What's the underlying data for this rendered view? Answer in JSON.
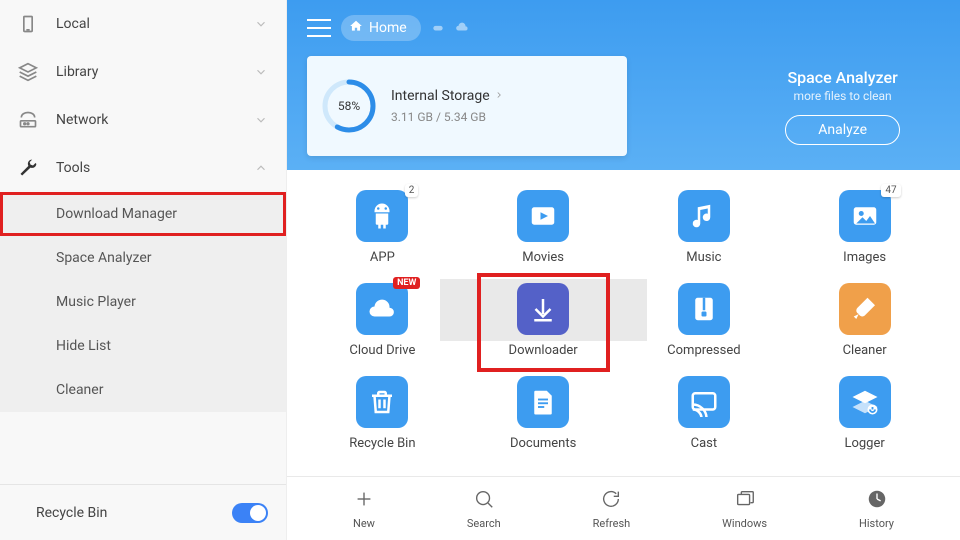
{
  "sidebar": {
    "items": [
      {
        "label": "Local",
        "icon": "phone-icon",
        "expanded": false
      },
      {
        "label": "Library",
        "icon": "stack-icon",
        "expanded": false
      },
      {
        "label": "Network",
        "icon": "router-icon",
        "expanded": false
      },
      {
        "label": "Tools",
        "icon": "wrench-icon",
        "expanded": true
      }
    ],
    "tools_children": [
      {
        "label": "Download Manager",
        "highlighted": true
      },
      {
        "label": "Space Analyzer"
      },
      {
        "label": "Music Player"
      },
      {
        "label": "Hide List"
      },
      {
        "label": "Cleaner"
      }
    ],
    "recycle_bin": "Recycle Bin",
    "recycle_toggle_on": true
  },
  "header": {
    "home_label": "Home",
    "storage": {
      "percent_text": "58%",
      "percent": 58,
      "title": "Internal Storage",
      "detail": "3.11 GB / 5.34 GB"
    },
    "analyzer": {
      "title": "Space Analyzer",
      "subtitle": "more files to clean",
      "button": "Analyze"
    }
  },
  "grid": [
    {
      "name": "app",
      "label": "APP",
      "icon": "android",
      "color": "bg-blue",
      "badge": "2"
    },
    {
      "name": "movies",
      "label": "Movies",
      "icon": "play",
      "color": "bg-blue"
    },
    {
      "name": "music",
      "label": "Music",
      "icon": "note",
      "color": "bg-blue"
    },
    {
      "name": "images",
      "label": "Images",
      "icon": "image",
      "color": "bg-blue",
      "badge": "47"
    },
    {
      "name": "cloud-drive",
      "label": "Cloud Drive",
      "icon": "cloud",
      "color": "bg-blue",
      "new_badge": "NEW"
    },
    {
      "name": "downloader",
      "label": "Downloader",
      "icon": "download",
      "color": "bg-indigo",
      "highlighted": true,
      "selected": true
    },
    {
      "name": "compressed",
      "label": "Compressed",
      "icon": "zip",
      "color": "bg-blue"
    },
    {
      "name": "cleaner",
      "label": "Cleaner",
      "icon": "brush",
      "color": "bg-orange"
    },
    {
      "name": "recycle-bin",
      "label": "Recycle Bin",
      "icon": "trash",
      "color": "bg-blue"
    },
    {
      "name": "documents",
      "label": "Documents",
      "icon": "doc",
      "color": "bg-blue"
    },
    {
      "name": "cast",
      "label": "Cast",
      "icon": "cast",
      "color": "bg-blue"
    },
    {
      "name": "logger",
      "label": "Logger",
      "icon": "layers",
      "color": "bg-blue"
    }
  ],
  "bottom": [
    {
      "name": "new",
      "label": "New",
      "icon": "plus"
    },
    {
      "name": "search",
      "label": "Search",
      "icon": "search"
    },
    {
      "name": "refresh",
      "label": "Refresh",
      "icon": "refresh"
    },
    {
      "name": "windows",
      "label": "Windows",
      "icon": "windows"
    },
    {
      "name": "history",
      "label": "History",
      "icon": "clock"
    }
  ]
}
